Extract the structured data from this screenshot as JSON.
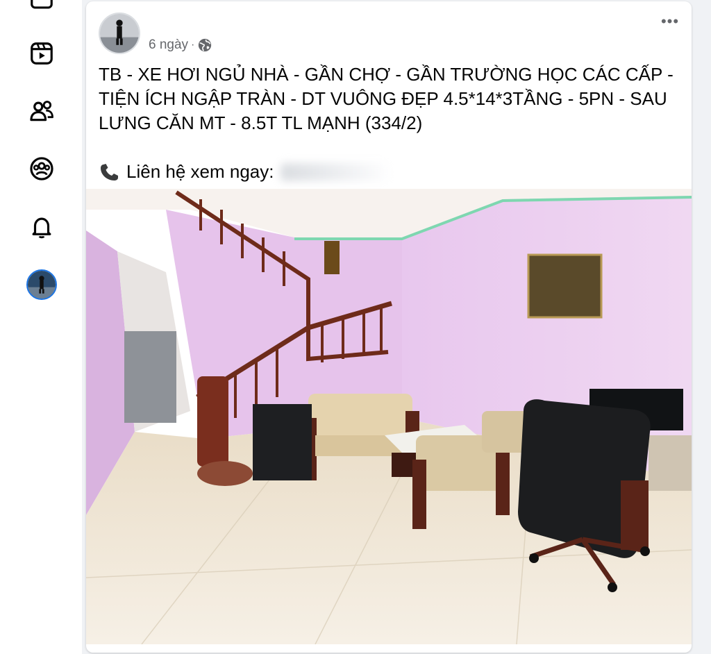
{
  "nav": {
    "items": [
      {
        "name": "watch-icon"
      },
      {
        "name": "friends-icon"
      },
      {
        "name": "groups-icon"
      },
      {
        "name": "bell-icon"
      }
    ]
  },
  "post": {
    "author": "",
    "time": "6 ngày",
    "separator": "·",
    "privacy_icon": "globe-icon",
    "more": "•••",
    "text": "TB - XE HƠI NGỦ NHÀ - GẦN CHỢ - GẦN TRƯỜNG HỌC CÁC CẤP -\nTIỆN ÍCH NGẬP TRÀN - DT VUÔNG ĐẸP 4.5*14*3TẦNG - 5PN - SAU\nLƯNG CĂN MT - 8.5T TL MẠNH (334/2)",
    "contact_label": "Liên hệ xem ngay:",
    "contact_icon": "phone-icon"
  },
  "colors": {
    "accent": "#1b74e4",
    "text": "#050505",
    "muted": "#65676b",
    "wall": "#e8c7ee",
    "floor": "#efe6d4"
  }
}
